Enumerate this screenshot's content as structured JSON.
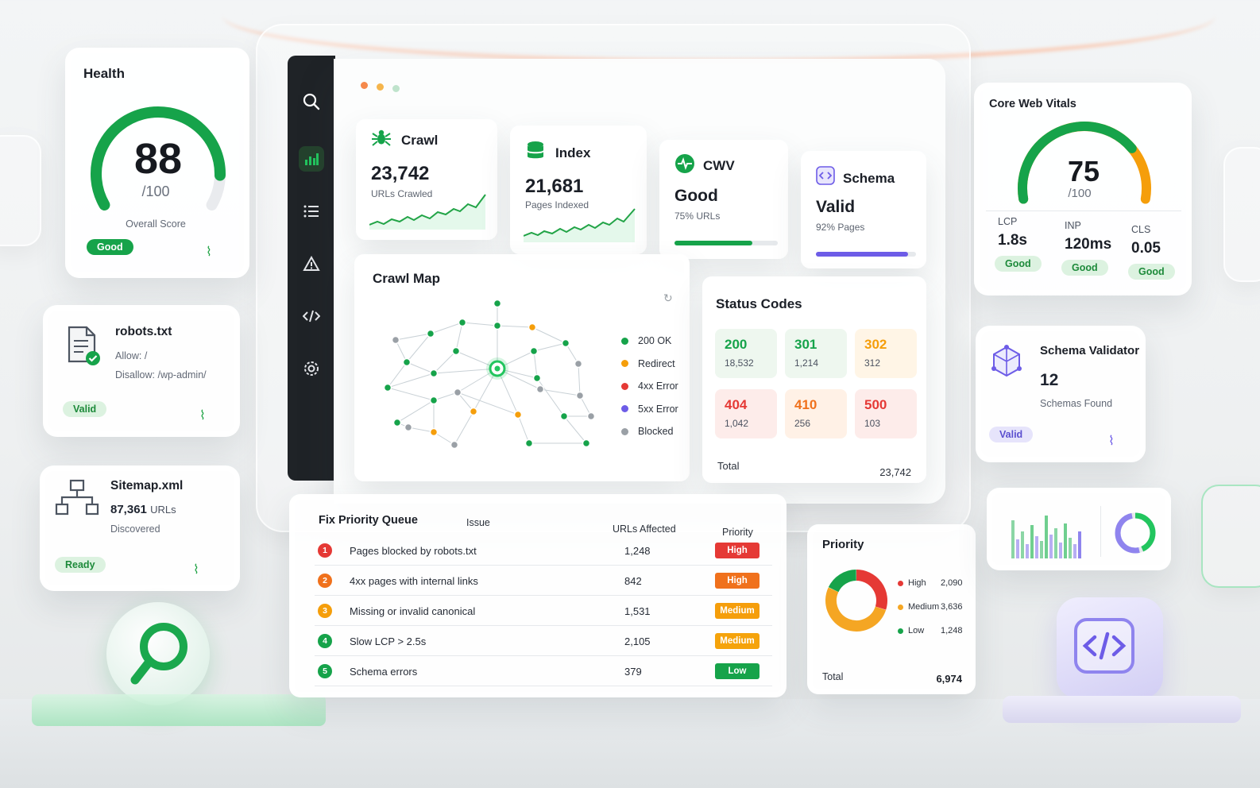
{
  "colors": {
    "green": "#16a34a",
    "orange": "#f59e0b",
    "red": "#e53935",
    "purple": "#6d5ce7",
    "grey": "#9aa0a6",
    "sidebar": "#1f2327"
  },
  "health": {
    "title": "Health",
    "score": "88",
    "max": "/100",
    "caption": "Overall Score",
    "badge": "Good",
    "score_fraction": 0.88
  },
  "robots": {
    "title": "robots.txt",
    "line1": "Allow: /",
    "line2": "Disallow: /wp-admin/",
    "badge": "Valid"
  },
  "sitemap": {
    "title": "Sitemap.xml",
    "count": "87,361",
    "unit": "URLs",
    "caption": "Discovered",
    "badge": "Ready"
  },
  "sidebar": {
    "icons": [
      "search-icon",
      "chart-icon",
      "list-icon",
      "warning-icon",
      "code-icon",
      "gear-icon"
    ],
    "active": "chart-icon"
  },
  "kpis": {
    "crawl": {
      "label": "Crawl",
      "value": "23,742",
      "sub": "URLs Crawled"
    },
    "index": {
      "label": "Index",
      "value": "21,681",
      "sub": "Pages Indexed"
    },
    "cwv": {
      "label": "CWV",
      "value": "Good",
      "sub": "75% URLs",
      "progress": 0.75
    },
    "schema": {
      "label": "Schema",
      "value": "Valid",
      "sub": "92% Pages",
      "progress": 0.92
    }
  },
  "crawl_map": {
    "title": "Crawl Map",
    "legend": [
      {
        "label": "200 OK",
        "color": "#16a34a"
      },
      {
        "label": "Redirect",
        "color": "#f59e0b"
      },
      {
        "label": "4xx Error",
        "color": "#e53935"
      },
      {
        "label": "5xx Error",
        "color": "#6d5ce7"
      },
      {
        "label": "Blocked",
        "color": "#9aa0a6"
      }
    ]
  },
  "status_codes": {
    "title": "Status Codes",
    "codes": [
      {
        "code": "200",
        "count": "18,532",
        "color": "#16a34a",
        "bg": "#eef7ef"
      },
      {
        "code": "301",
        "count": "1,214",
        "color": "#16a34a",
        "bg": "#eef7ef"
      },
      {
        "code": "302",
        "count": "312",
        "color": "#f59e0b",
        "bg": "#fff5e6"
      },
      {
        "code": "404",
        "count": "1,042",
        "color": "#e53935",
        "bg": "#fdecea"
      },
      {
        "code": "410",
        "count": "256",
        "color": "#f0711c",
        "bg": "#fff1e6"
      },
      {
        "code": "500",
        "count": "103",
        "color": "#e53935",
        "bg": "#fdecea"
      }
    ],
    "total_label": "Total",
    "total_value": "23,742"
  },
  "queue": {
    "title": "Fix Priority Queue",
    "col_issue": "Issue",
    "col_urls": "URLs Affected",
    "col_priority": "Priority",
    "rows": [
      {
        "num": "1",
        "issue": "Pages blocked by robots.txt",
        "urls": "1,248",
        "priority": "High",
        "num_color": "#e53935",
        "prio_color": "#e53935"
      },
      {
        "num": "2",
        "issue": "4xx pages with internal links",
        "urls": "842",
        "priority": "High",
        "num_color": "#f0711c",
        "prio_color": "#f0711c"
      },
      {
        "num": "3",
        "issue": "Missing or invalid canonical",
        "urls": "1,531",
        "priority": "Medium",
        "num_color": "#f59e0b",
        "prio_color": "#f59e0b"
      },
      {
        "num": "4",
        "issue": "Slow LCP > 2.5s",
        "urls": "2,105",
        "priority": "Medium",
        "num_color": "#16a34a",
        "prio_color": "#f5a30b"
      },
      {
        "num": "5",
        "issue": "Schema errors",
        "urls": "379",
        "priority": "Low",
        "num_color": "#16a34a",
        "prio_color": "#16a34a"
      }
    ]
  },
  "priority": {
    "title": "Priority",
    "items": [
      {
        "label": "High",
        "value": "2,090",
        "color": "#e53935",
        "amount": 2090
      },
      {
        "label": "Medium",
        "value": "3,636",
        "color": "#f5a623",
        "amount": 3636
      },
      {
        "label": "Low",
        "value": "1,248",
        "color": "#16a34a",
        "amount": 1248
      }
    ],
    "total_label": "Total",
    "total_value": "6,974"
  },
  "cwv_card": {
    "title": "Core Web Vitals",
    "score": "75",
    "max": "/100",
    "score_fraction": 0.75,
    "metrics": [
      {
        "label": "LCP",
        "value": "1.8s",
        "badge": "Good"
      },
      {
        "label": "INP",
        "value": "120ms",
        "badge": "Good"
      },
      {
        "label": "CLS",
        "value": "0.05",
        "badge": "Good"
      }
    ]
  },
  "schema_validator": {
    "title": "Schema Validator",
    "count": "12",
    "caption": "Schemas Found",
    "badge": "Valid"
  }
}
